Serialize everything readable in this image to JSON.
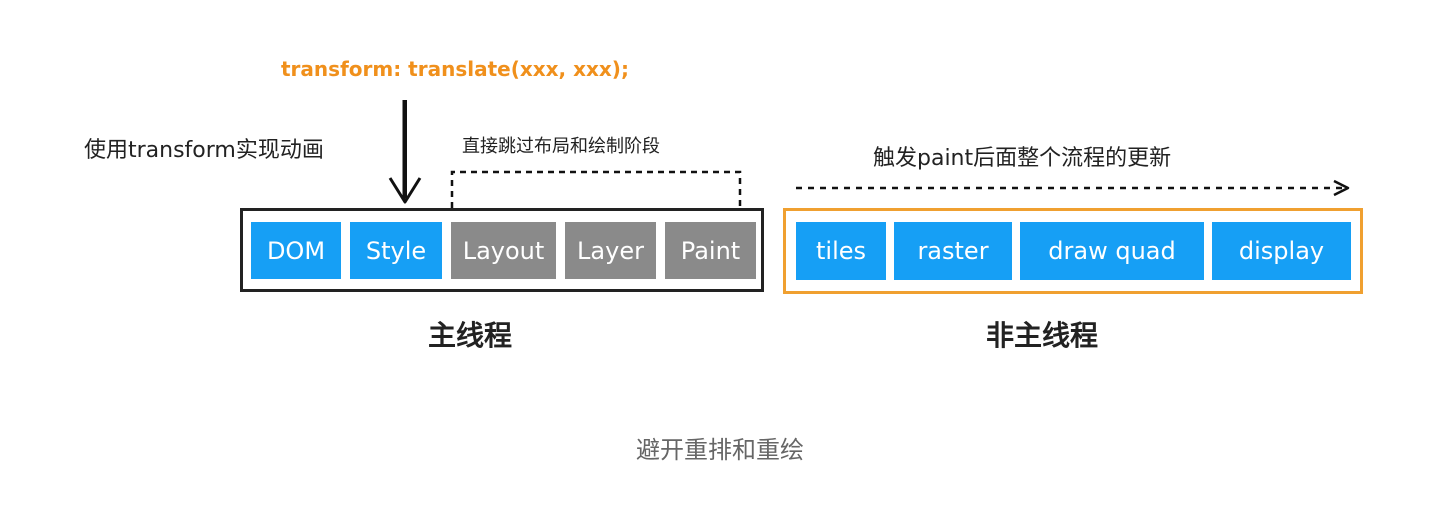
{
  "code_label": "transform: translate(xxx, xxx);",
  "use_transform_label": "使用transform实现动画",
  "skip_label": "直接跳过布局和绘制阶段",
  "trigger_label": "触发paint后面整个流程的更新",
  "main_thread": {
    "caption": "主线程",
    "stages": [
      {
        "label": "DOM",
        "state": "active"
      },
      {
        "label": "Style",
        "state": "active"
      },
      {
        "label": "Layout",
        "state": "skipped"
      },
      {
        "label": "Layer",
        "state": "skipped"
      },
      {
        "label": "Paint",
        "state": "skipped"
      }
    ]
  },
  "other_thread": {
    "caption": "非主线程",
    "stages": [
      {
        "label": "tiles"
      },
      {
        "label": "raster"
      },
      {
        "label": "draw quad"
      },
      {
        "label": "display"
      }
    ]
  },
  "figure_caption": "避开重排和重绘",
  "colors": {
    "active_stage": "#169ff5",
    "skipped_stage": "#8a8a8a",
    "code_text": "#f0901c",
    "other_thread_border": "#f0a030",
    "main_thread_border": "#222222"
  }
}
